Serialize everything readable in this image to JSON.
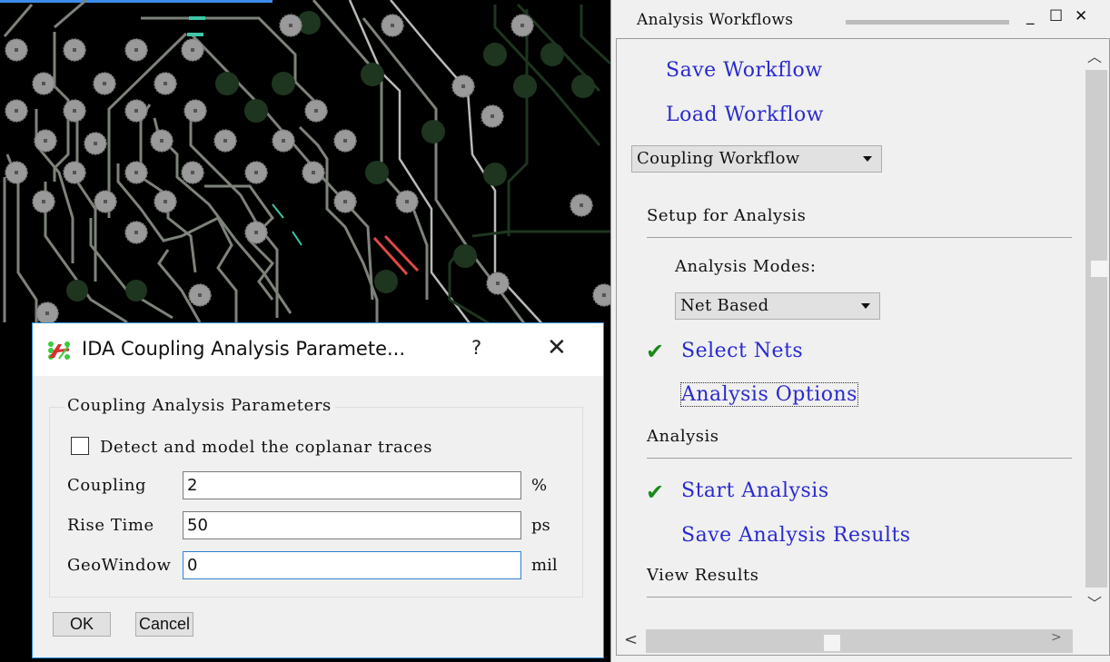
{
  "workflow_panel": {
    "title": "Analysis Workflows",
    "window_buttons": {
      "minimize": "_",
      "maximize": "☐",
      "close": "✕"
    },
    "links_top": [
      {
        "label": "Save Workflow"
      },
      {
        "label": "Load Workflow"
      }
    ],
    "workflow_select": {
      "selected": "Coupling Workflow"
    },
    "sections": {
      "setup": {
        "heading": "Setup for Analysis",
        "modes_label": "Analysis Modes:",
        "modes_select": {
          "selected": "Net Based"
        },
        "select_nets": {
          "label": "Select Nets",
          "completed": true
        },
        "analysis_options": {
          "label": "Analysis Options",
          "focused": true
        }
      },
      "analysis": {
        "heading": "Analysis",
        "start_analysis": {
          "label": "Start Analysis",
          "completed": true
        },
        "save_results": {
          "label": "Save Analysis Results"
        }
      },
      "view_results": {
        "heading": "View Results"
      }
    },
    "scrollbar": {
      "up": "^",
      "down": "v",
      "left": "<",
      "right": ">"
    }
  },
  "dialog": {
    "title": "IDA Coupling Analysis Paramete...",
    "help_label": "?",
    "close_label": "✕",
    "group_title": "Coupling Analysis Parameters",
    "checkbox": {
      "label": "Detect and model the coplanar traces",
      "checked": false
    },
    "fields": [
      {
        "label": "Coupling",
        "value": "2",
        "unit": "%"
      },
      {
        "label": "Rise Time",
        "value": "50",
        "unit": "ps"
      },
      {
        "label": "GeoWindow",
        "value": "0",
        "unit": "mil"
      }
    ],
    "ok_label": "OK",
    "cancel_label": "Cancel"
  },
  "colors": {
    "link": "#2a2ad0",
    "check": "#1a8a1a",
    "dialog_border": "#2f8fd8",
    "pcb_background": "#000000",
    "pcb_trace": "#7d837a",
    "pcb_pad": "#9a9a9a",
    "pcb_highlight_cyan": "#3fc7a8",
    "pcb_highlight_red": "#e04848"
  }
}
